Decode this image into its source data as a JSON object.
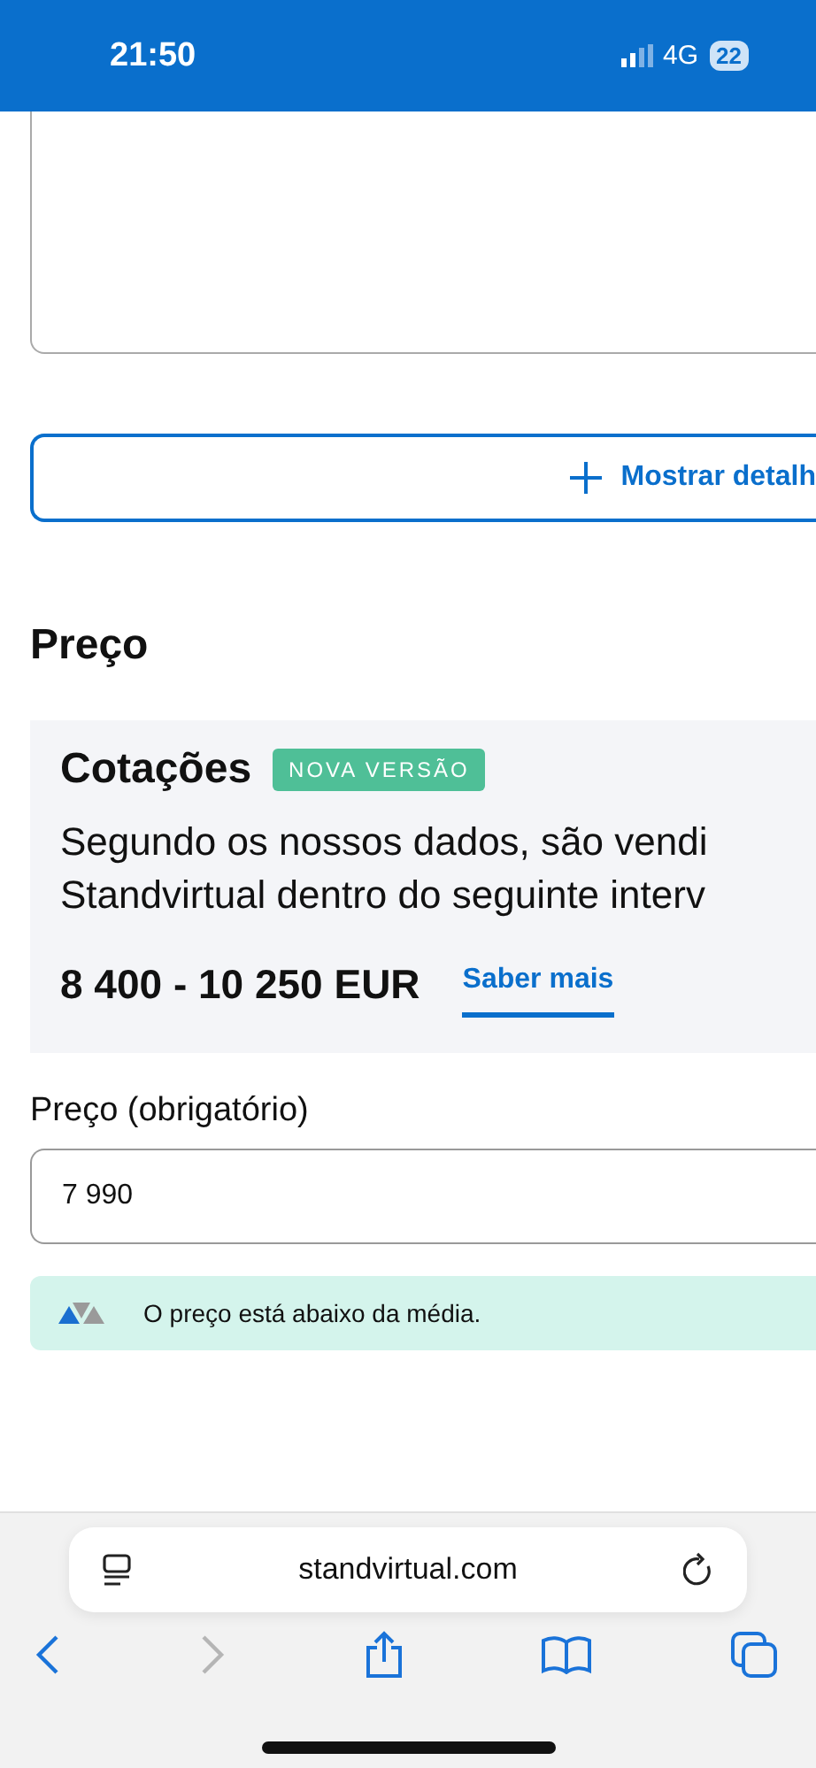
{
  "status_bar": {
    "time": "21:50",
    "network": "4G",
    "battery": "22"
  },
  "show_details_button": {
    "label": "Mostrar detalh"
  },
  "price_section": {
    "title": "Preço",
    "quotes_card": {
      "title": "Cotações",
      "badge": "NOVA VERSÃO",
      "description_lines": [
        "Segundo os nossos dados, são vendi",
        "Standvirtual dentro do seguinte interv"
      ],
      "range": "8 400 - 10 250 EUR",
      "link": "Saber mais"
    },
    "price_field": {
      "label": "Preço (obrigatório)",
      "value": "7 990"
    },
    "price_notice": {
      "text": "O preço está abaixo da média."
    }
  },
  "browser": {
    "url": "standvirtual.com",
    "back_disabled": false,
    "forward_disabled": true
  }
}
